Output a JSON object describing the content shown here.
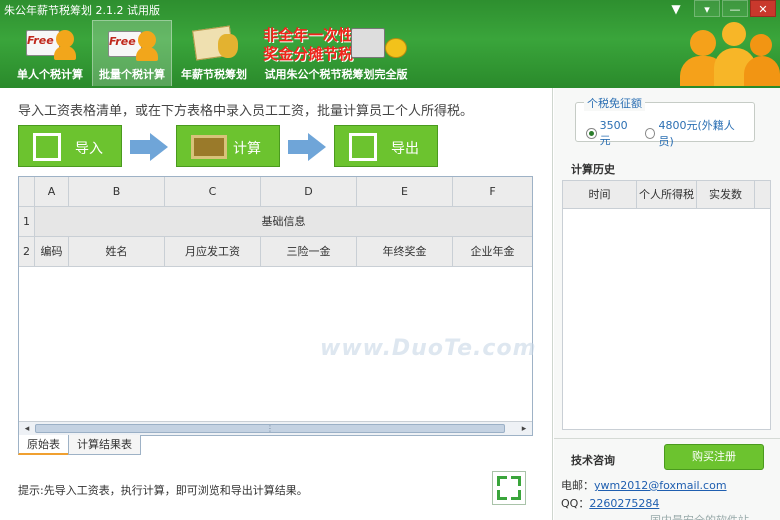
{
  "app": {
    "title": "朱公年薪节税筹划 2.1.2 试用版",
    "win_min": "▾",
    "win_restore": "—",
    "win_close": "✕"
  },
  "nav": {
    "items": [
      {
        "label": "单人个税计算",
        "icon": "free-calculator-icon"
      },
      {
        "label": "批量个税计算",
        "icon": "free-batch-icon",
        "active": true
      },
      {
        "label": "年薪节税筹划",
        "icon": "money-bag-icon"
      },
      {
        "label": "试用朱公个税节税筹划完全版",
        "icon": "calculator-coins-icon"
      }
    ],
    "promo_line1": "非全年一次性",
    "promo_line2": "奖金分摊节税"
  },
  "main": {
    "instruction": "导入工资表格清单，或在下方表格中录入员工工资，批量计算员工个人所得税。",
    "actions": {
      "import": "导入",
      "calculate": "计算",
      "export": "导出"
    },
    "grid": {
      "columns": [
        "A",
        "B",
        "C",
        "D",
        "E",
        "F"
      ],
      "row1_label": "1",
      "row2_label": "2",
      "merged_header": "基础信息",
      "row2_cells": [
        "编码",
        "姓名",
        "月应发工资",
        "三险一金",
        "年终奖金",
        "企业年金"
      ],
      "hscroll_left": "◂",
      "hscroll_right": "▸",
      "hscroll_grip": "⋮"
    },
    "sheets": [
      "原始表",
      "计算结果表"
    ],
    "tip": "提示:先导入工资表，执行计算，即可浏览和导出计算结果。",
    "watermark": "www.DuoTe.com"
  },
  "side": {
    "exempt_title": "个税免征额",
    "exempt_options": [
      {
        "label": "3500元",
        "selected": true
      },
      {
        "label": "4800元(外籍人员)",
        "selected": false
      }
    ],
    "history_title": "计算历史",
    "history_columns": [
      "时间",
      "个人所得税",
      "实发数"
    ],
    "tech_title": "技术咨询",
    "purchase_label": "购买注册",
    "email_label": "电邮：",
    "email": "ywm2012@foxmail.com",
    "qq_label": "QQ：",
    "qq": "2260275284",
    "bottom_text": "国内最安全的软件站"
  }
}
